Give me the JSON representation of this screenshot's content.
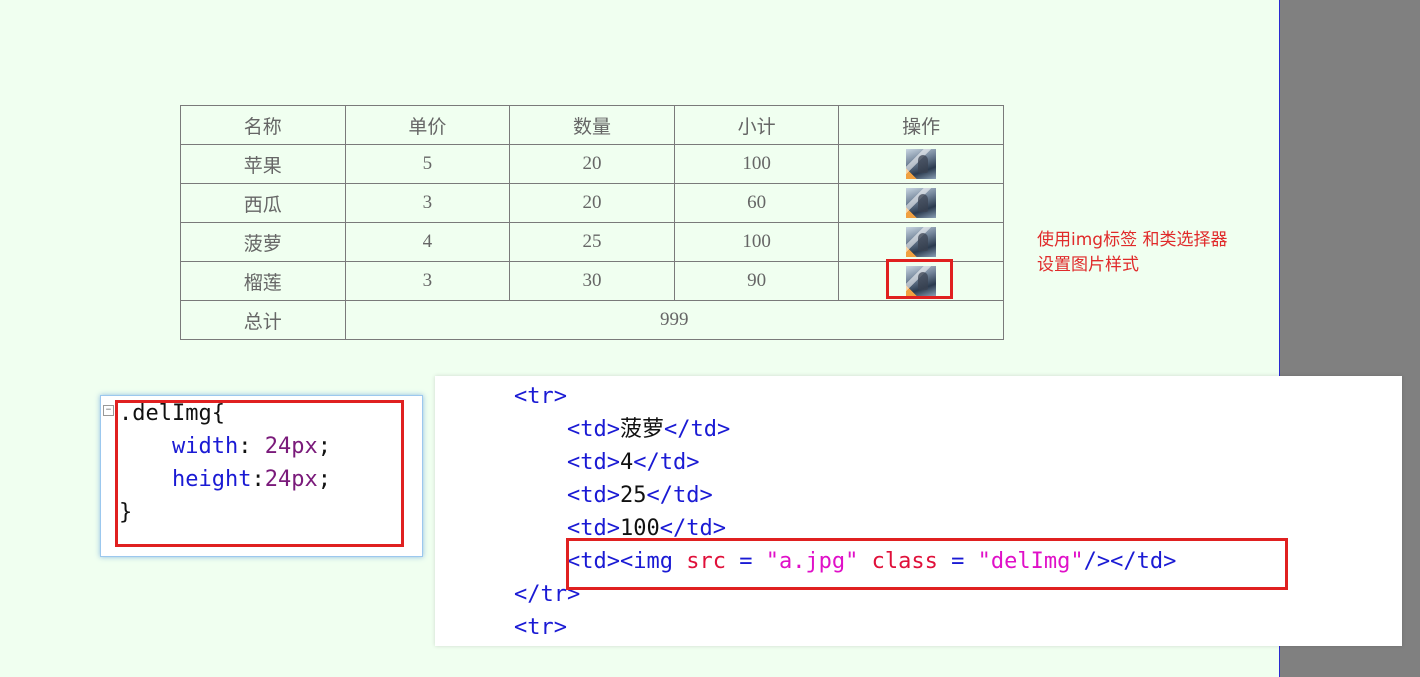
{
  "table": {
    "headers": [
      "名称",
      "单价",
      "数量",
      "小计",
      "操作"
    ],
    "rows": [
      {
        "name": "苹果",
        "price": "5",
        "qty": "20",
        "subtotal": "100",
        "action_icon": "thumbnail-image-icon"
      },
      {
        "name": "西瓜",
        "price": "3",
        "qty": "20",
        "subtotal": "60",
        "action_icon": "thumbnail-image-icon"
      },
      {
        "name": "菠萝",
        "price": "4",
        "qty": "25",
        "subtotal": "100",
        "action_icon": "thumbnail-image-icon"
      },
      {
        "name": "榴莲",
        "price": "3",
        "qty": "30",
        "subtotal": "90",
        "action_icon": "thumbnail-image-icon"
      }
    ],
    "total_label": "总计",
    "total_value": "999"
  },
  "note": {
    "line1": "使用img标签 和类选择器",
    "line2": "设置图片样式"
  },
  "css_snippet": {
    "selector": ".delImg{",
    "prop1": "width",
    "val1": " 24px",
    "prop2": "height",
    "val2": "24px",
    "close": "}"
  },
  "html_snippet": {
    "tr_open": "<tr>",
    "td_open": "<td>",
    "td_close": "</td>",
    "cell_name": "菠萝",
    "cell_price": "4",
    "cell_qty": "25",
    "cell_subtotal": "100",
    "img_tag_start": "<img ",
    "attr_src": "src",
    "eq": " = ",
    "src_value": "\"a.jpg\"",
    "attr_class": "class",
    "class_value": "\"delImg\"",
    "img_tag_end": "/>",
    "tr_close": "</tr>"
  },
  "colors": {
    "background": "#f0fff0",
    "highlight": "#e02020",
    "tag": "#1a1ad4",
    "attribute": "#e0103a",
    "string": "#e010c8"
  }
}
